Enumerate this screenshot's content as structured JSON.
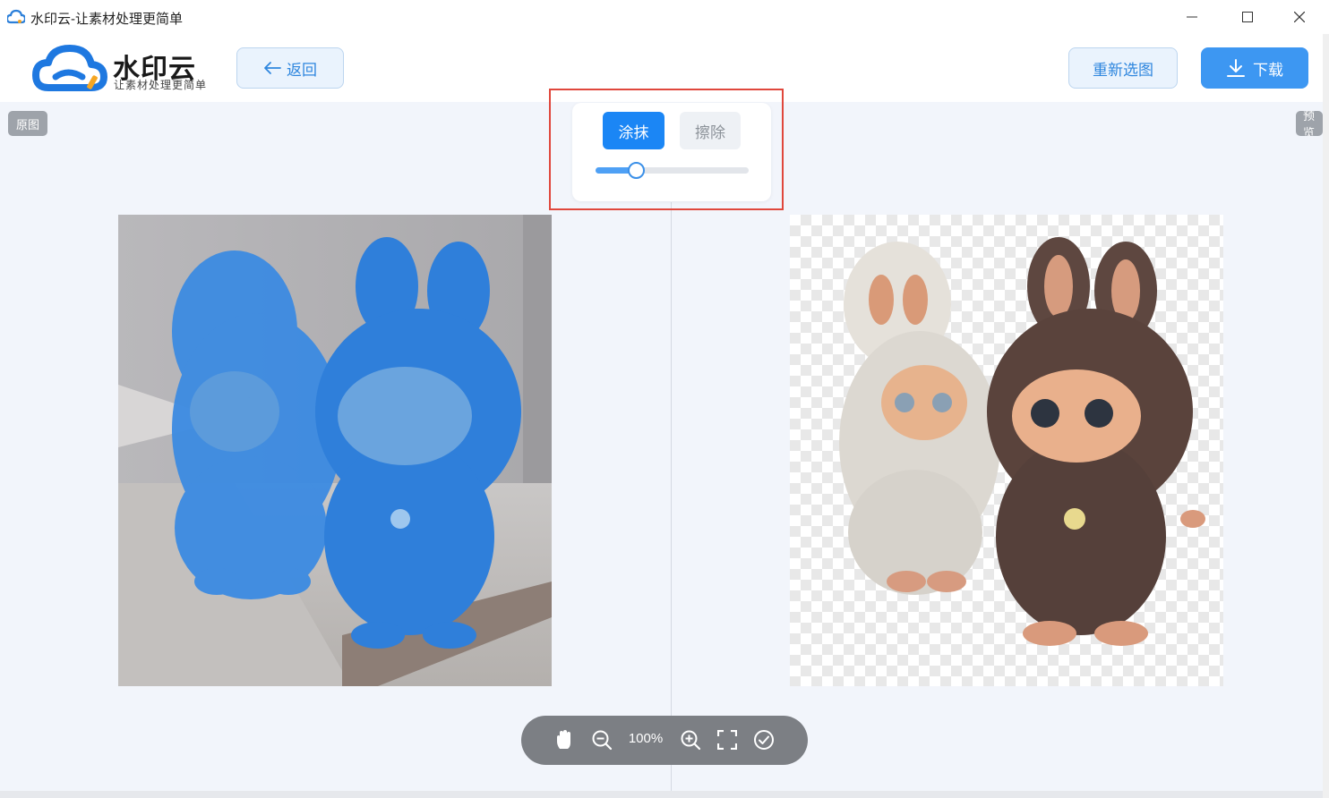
{
  "window": {
    "title": "水印云-让素材处理更简单"
  },
  "header": {
    "logo_title": "水印云",
    "logo_subtitle": "让素材处理更简单",
    "back_label": "返回",
    "reselect_label": "重新选图",
    "download_label": "下载"
  },
  "panels": {
    "original_tag": "原图",
    "preview_tag": "预览"
  },
  "brush": {
    "paint_label": "涂抹",
    "erase_label": "擦除",
    "active_mode": "涂抹",
    "size_fraction": 0.27
  },
  "zoom": {
    "level": "100%",
    "tools": [
      "hand-icon",
      "zoom-out-icon",
      "zoom-in-icon",
      "fullscreen-icon",
      "confirm-icon"
    ]
  },
  "colors": {
    "accent": "#1b86f5",
    "mask_blue": "#3a86dc",
    "highlight_border": "#e0473c"
  }
}
